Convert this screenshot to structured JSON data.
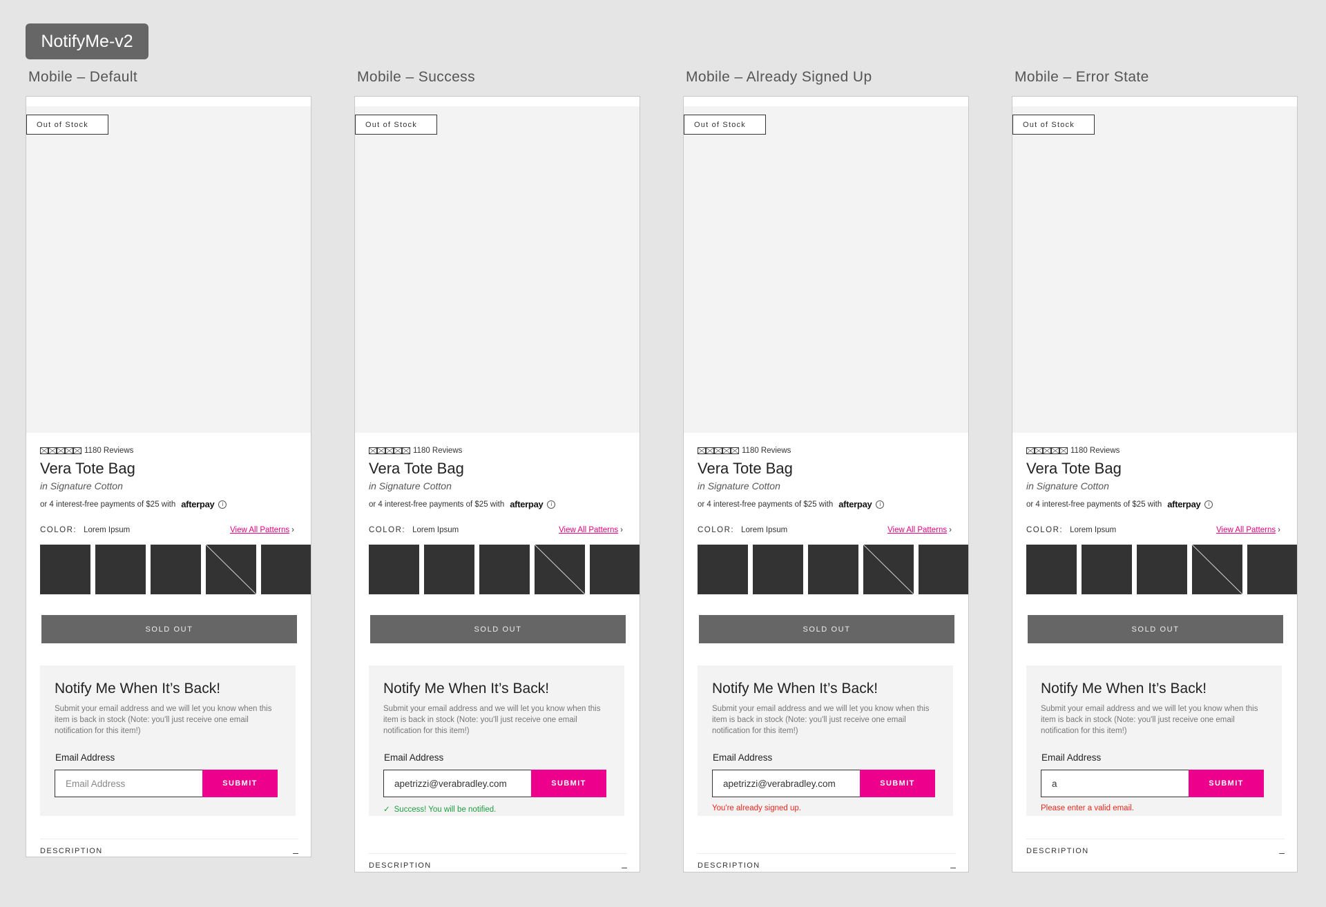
{
  "board_title": "NotifyMe-v2",
  "product": {
    "badge": "Out of Stock",
    "reviews": "1180 Reviews",
    "rating_stars": 5,
    "title": "Vera Tote Bag",
    "subtitle": "in Signature Cotton",
    "afterpay_text": "or 4 interest-free payments of $25 with",
    "afterpay_logo": "afterpay",
    "info_icon": "i",
    "color_label": "COLOR:",
    "color_value": "Lorem Ipsum",
    "view_all": "View All Patterns",
    "chevron": "›",
    "sold_out": "SOLD OUT"
  },
  "notify": {
    "title": "Notify Me When It’s Back!",
    "body": "Submit your email address and we will let you know when this item is back in stock (Note: you'll just receive one email notification for this item!)",
    "email_label": "Email Address",
    "placeholder": "Email Address",
    "submit": "SUBMIT"
  },
  "description": {
    "label": "DESCRIPTION",
    "toggle": "–"
  },
  "colors": {
    "accent": "#ec008c",
    "success": "#1e9e3e",
    "error": "#e8281e",
    "sold_out_bg": "#666666",
    "swatch": "#333333"
  },
  "frames": [
    {
      "label": "Mobile – Default",
      "email_value": "",
      "message": ""
    },
    {
      "label": "Mobile – Success",
      "email_value": "apetrizzi@verabradley.com",
      "message": "Success! You will be notified.",
      "check": "✓"
    },
    {
      "label": "Mobile – Already Signed Up",
      "email_value": "apetrizzi@verabradley.com",
      "message": "You're already signed up."
    },
    {
      "label": "Mobile – Error State",
      "email_value": "a",
      "message": "Please enter a valid email."
    }
  ]
}
